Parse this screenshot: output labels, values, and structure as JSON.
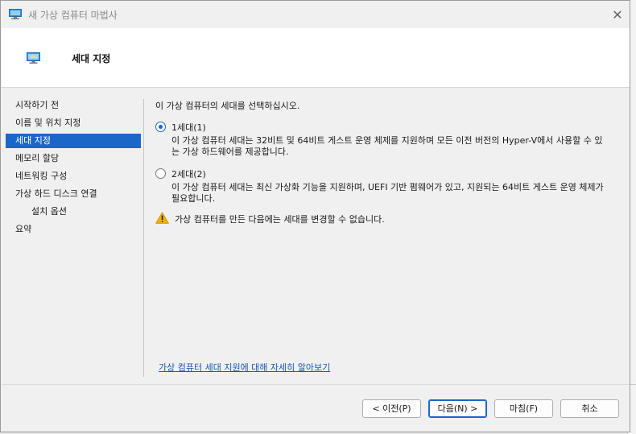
{
  "window": {
    "title": "새 가상 컴퓨터 마법사",
    "close_glyph": "✕"
  },
  "header": {
    "title": "세대 지정",
    "icon": "vm-monitor-icon"
  },
  "sidebar": {
    "items": [
      {
        "label": "시작하기 전",
        "active": false
      },
      {
        "label": "이름 및 위치 지정",
        "active": false
      },
      {
        "label": "세대 지정",
        "active": true
      },
      {
        "label": "메모리 할당",
        "active": false
      },
      {
        "label": "네트워킹 구성",
        "active": false
      },
      {
        "label": "가상 하드 디스크 연결",
        "active": false
      },
      {
        "label": "설치 옵션",
        "active": false,
        "sub": true
      },
      {
        "label": "요약",
        "active": false
      }
    ]
  },
  "main": {
    "prompt": "이 가상 컴퓨터의 세대를 선택하십시오.",
    "options": [
      {
        "label": "1세대(1)",
        "checked": true,
        "desc": "이 가상 컴퓨터 세대는 32비트 및 64비트 게스트 운영 체제를 지원하며 모든 이전 버전의 Hyper-V에서 사용할 수 있는 가상 하드웨어를 제공합니다."
      },
      {
        "label": "2세대(2)",
        "checked": false,
        "desc": "이 가상 컴퓨터 세대는 최신 가상화 기능을 지원하며, UEFI 기반 펌웨어가 있고, 지원되는 64비트 게스트 운영 체제가 필요합니다."
      }
    ],
    "warning": "가상 컴퓨터를 만든 다음에는 세대를 변경할 수 없습니다.",
    "learn_more": "가상 컴퓨터 세대 지원에 대해 자세히 알아보기"
  },
  "footer": {
    "prev": "< 이전(P)",
    "next": "다음(N) >",
    "finish": "마침(F)",
    "cancel": "취소"
  },
  "colors": {
    "accent": "#1b66c9",
    "warning": "#f2b100",
    "link": "#1b56b8"
  }
}
